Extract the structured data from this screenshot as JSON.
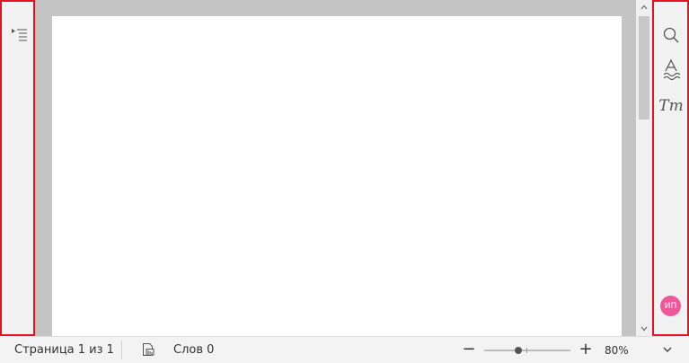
{
  "left_panel": {
    "navigation_icon": "navigation-pane-icon"
  },
  "document": {
    "page_color": "#ffffff",
    "canvas_color": "#c4c4c4"
  },
  "right_panel": {
    "search_icon": "search-icon",
    "format_icon": "text-format-icon",
    "text_style_icon": "text-style-icon",
    "text_style_glyph": "Tт",
    "avatar_initials": "ИП",
    "avatar_color": "#f0569a"
  },
  "status_bar": {
    "page_info": "Страница 1 из 1",
    "word_count": "Слов 0",
    "zoom_out_glyph": "−",
    "zoom_in_glyph": "+",
    "zoom_level": "80%",
    "zoom_fraction": 0.4
  },
  "colors": {
    "highlight_border": "#e81123"
  }
}
